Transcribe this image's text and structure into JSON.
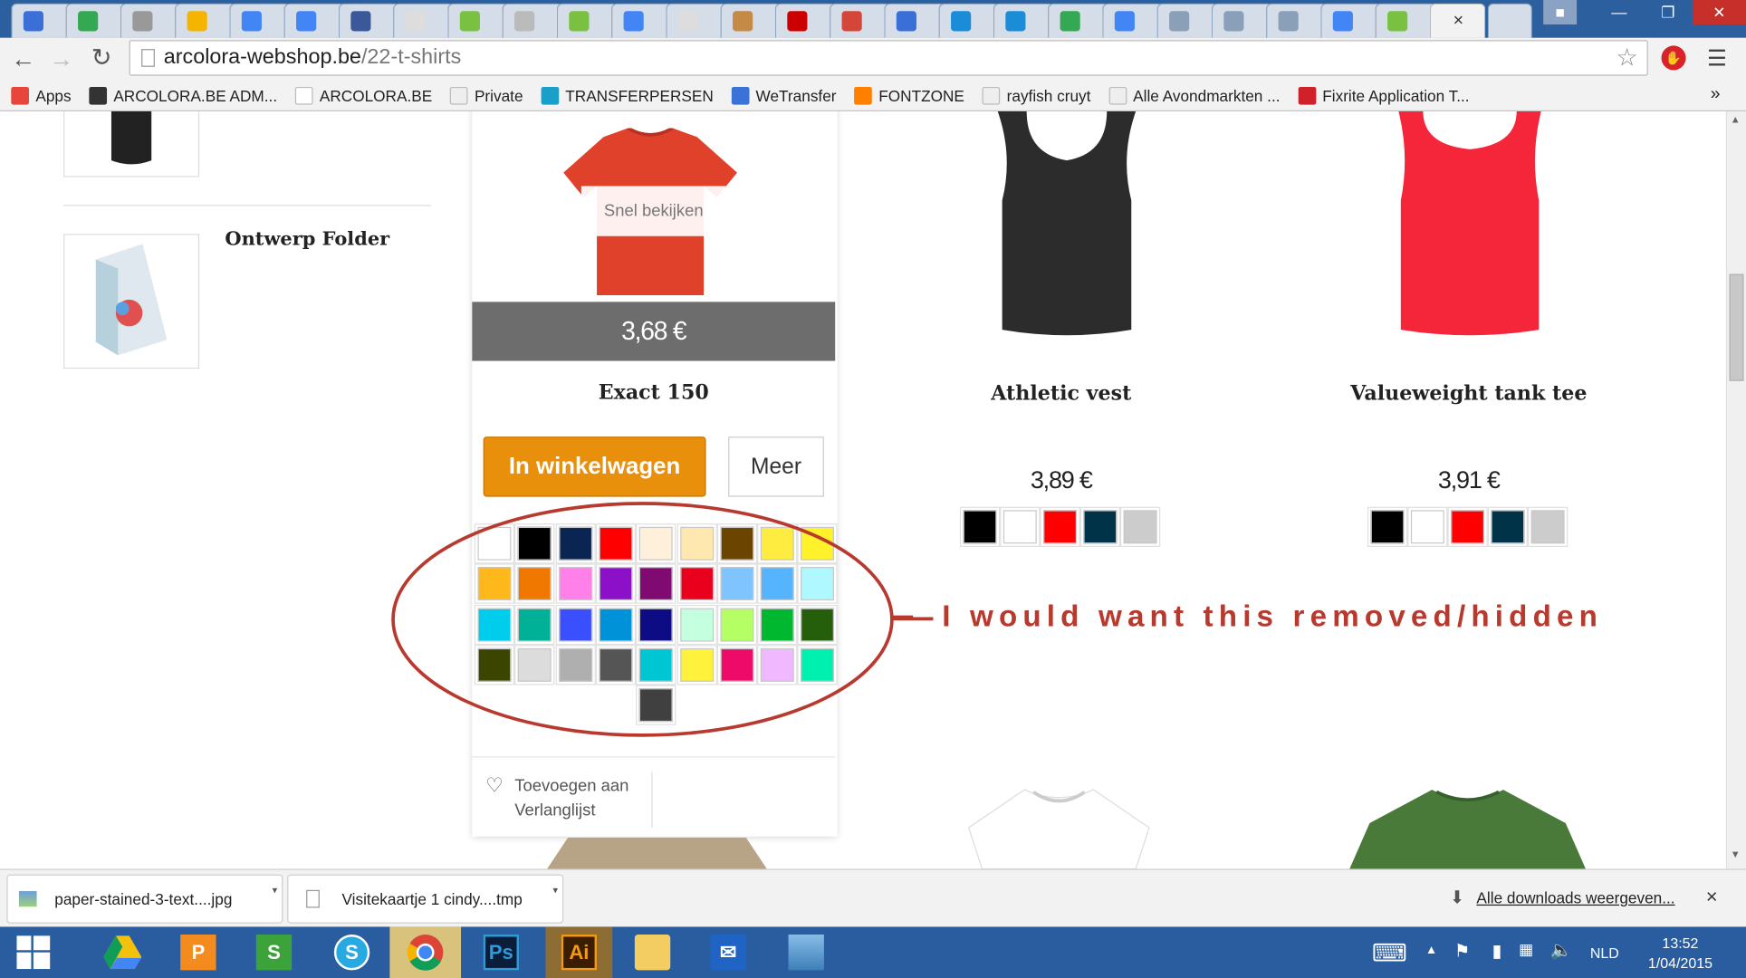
{
  "browser": {
    "url": "arcolora-webshop.be/22-t-shirts",
    "url_host": "arcolora-webshop.be",
    "url_path": "/22-t-shirts",
    "tab_close": "×"
  },
  "bookmarks": [
    {
      "label": "Apps",
      "color": "#e8453c"
    },
    {
      "label": "ARCOLORA.BE ADM...",
      "color": "#333333"
    },
    {
      "label": "ARCOLORA.BE",
      "color": "#ffffff"
    },
    {
      "label": "Private",
      "color": "#eeeeee"
    },
    {
      "label": "TRANSFERPERSEN",
      "color": "#1aa0c8"
    },
    {
      "label": "WeTransfer",
      "color": "#3a72d8"
    },
    {
      "label": "FONTZONE",
      "color": "#ff8000"
    },
    {
      "label": "rayfish cruyt",
      "color": "#eeeeee"
    },
    {
      "label": "Alle Avondmarkten ...",
      "color": "#eeeeee"
    },
    {
      "label": "Fixrite Application T...",
      "color": "#d0202a"
    }
  ],
  "sidebar": {
    "item_title": "Ontwerp Folder"
  },
  "products": {
    "featured": {
      "quick_view": "Snel bekijken",
      "price": "3,68 €",
      "name": "Exact 150",
      "add_to_cart": "In winkelwagen",
      "more": "Meer",
      "wishlist_line1": "Toevoegen aan",
      "wishlist_line2": "Verlanglijst",
      "colors": [
        "#ffffff",
        "#000000",
        "#0b2553",
        "#ff0000",
        "#fff0dc",
        "#ffe7b0",
        "#6b4500",
        "#ffec40",
        "#fff22a",
        "#ffb81c",
        "#f07800",
        "#ff80e8",
        "#8c10c8",
        "#7e0a72",
        "#e8001c",
        "#80c4ff",
        "#56b4ff",
        "#b0f8ff",
        "#00cdec",
        "#00b097",
        "#3a50ff",
        "#0092d8",
        "#0d0c84",
        "#c4ffe0",
        "#b4ff64",
        "#00b830",
        "#255f0c",
        "#3b4500",
        "#dcdcdc",
        "#afafaf",
        "#555555",
        "#00c6d4",
        "#fff23c",
        "#ee0a68",
        "#f0b8ff",
        "#00f0b0",
        "#404040"
      ]
    },
    "athletic": {
      "name": "Athletic vest",
      "price": "3,89 €",
      "colors": [
        "#000000",
        "#ffffff",
        "#ff0000",
        "#003348",
        "#cccccc"
      ]
    },
    "valueweight": {
      "name": "Valueweight tank tee",
      "price": "3,91 €",
      "colors": [
        "#000000",
        "#ffffff",
        "#ff0000",
        "#003348",
        "#cccccc"
      ]
    }
  },
  "annotation": {
    "text": "I would want this removed/hidden",
    "color": "#b83a2e"
  },
  "downloads": {
    "item1": "paper-stained-3-text....jpg",
    "item2": "Visitekaartje 1 cindy....tmp",
    "all": "Alle downloads weergeven...",
    "close": "×"
  },
  "taskbar": {
    "time": "13:52",
    "date": "1/04/2015",
    "lang": "NLD"
  }
}
